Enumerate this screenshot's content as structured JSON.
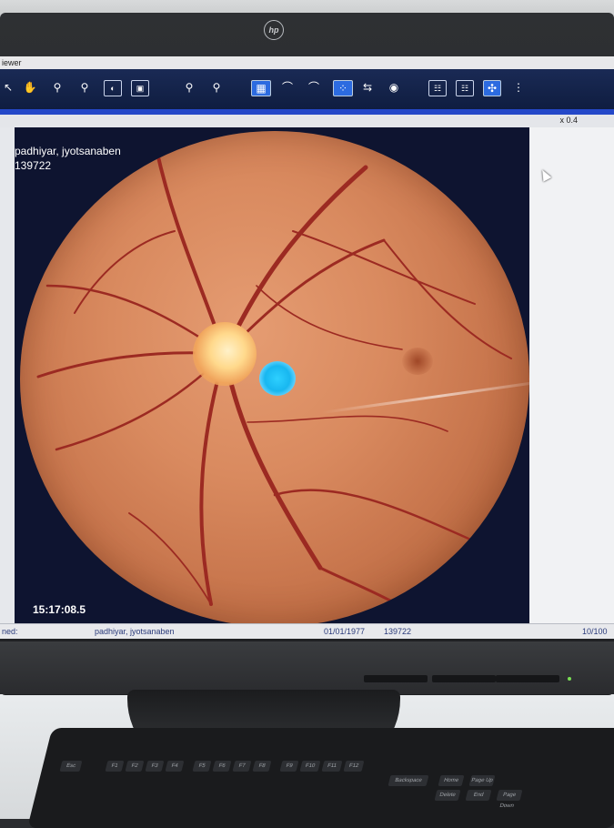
{
  "window": {
    "title": "iewer",
    "zoom_label": "x 0.4"
  },
  "toolbar": {
    "tools": [
      "cursor-arrow",
      "pan-hand",
      "zoom-in",
      "zoom-out",
      "invert",
      "crop",
      "measure-1",
      "measure-2",
      "compare",
      "histogram-1",
      "histogram-2",
      "grid-view",
      "flip",
      "snapshot",
      "layout-1",
      "layout-2",
      "settings",
      "info"
    ]
  },
  "viewer": {
    "patient_name": "padhiyar, jyotsanaben",
    "patient_id": "139722",
    "timestamp": "15:17:08.5"
  },
  "statusbar": {
    "left_label": "ned:",
    "patient_name": "padhiyar, jyotsanaben",
    "dob": "01/01/1977",
    "patient_id": "139722",
    "page": "10/100"
  },
  "monitor": {
    "brand": "hp"
  },
  "keyboard": {
    "keys": [
      "Esc",
      "F1",
      "F2",
      "F3",
      "F4",
      "F5",
      "F6",
      "F7",
      "F8",
      "F9",
      "F10",
      "F11",
      "F12",
      "Backspace",
      "Delete",
      "Page Up",
      "Page Down",
      "Home",
      "End"
    ]
  }
}
